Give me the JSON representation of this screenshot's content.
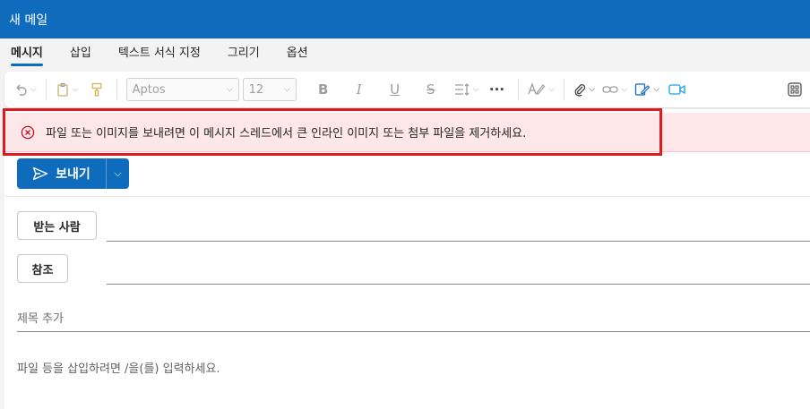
{
  "window": {
    "title": "새 메일"
  },
  "tabs": [
    {
      "label": "메시지",
      "active": true
    },
    {
      "label": "삽입"
    },
    {
      "label": "텍스트 서식 지정"
    },
    {
      "label": "그리기"
    },
    {
      "label": "옵션"
    }
  ],
  "ribbon": {
    "font_name": "Aptos",
    "font_size": "12",
    "more_label": "···"
  },
  "alert": {
    "message": "파일 또는 이미지를 보내려면 이 메시지 스레드에서 큰 인라인 이미지 또는 첨부 파일을 제거하세요.",
    "color": "#fde7e9",
    "highlight_color": "#e0191f"
  },
  "compose": {
    "send_label": "보내기",
    "to_label": "받는 사람",
    "cc_label": "참조",
    "subject_placeholder": "제목 추가",
    "body_hint": "파일 등을 삽입하려면 /을(를) 입력하세요."
  },
  "colors": {
    "accent": "#0f6cbd"
  }
}
